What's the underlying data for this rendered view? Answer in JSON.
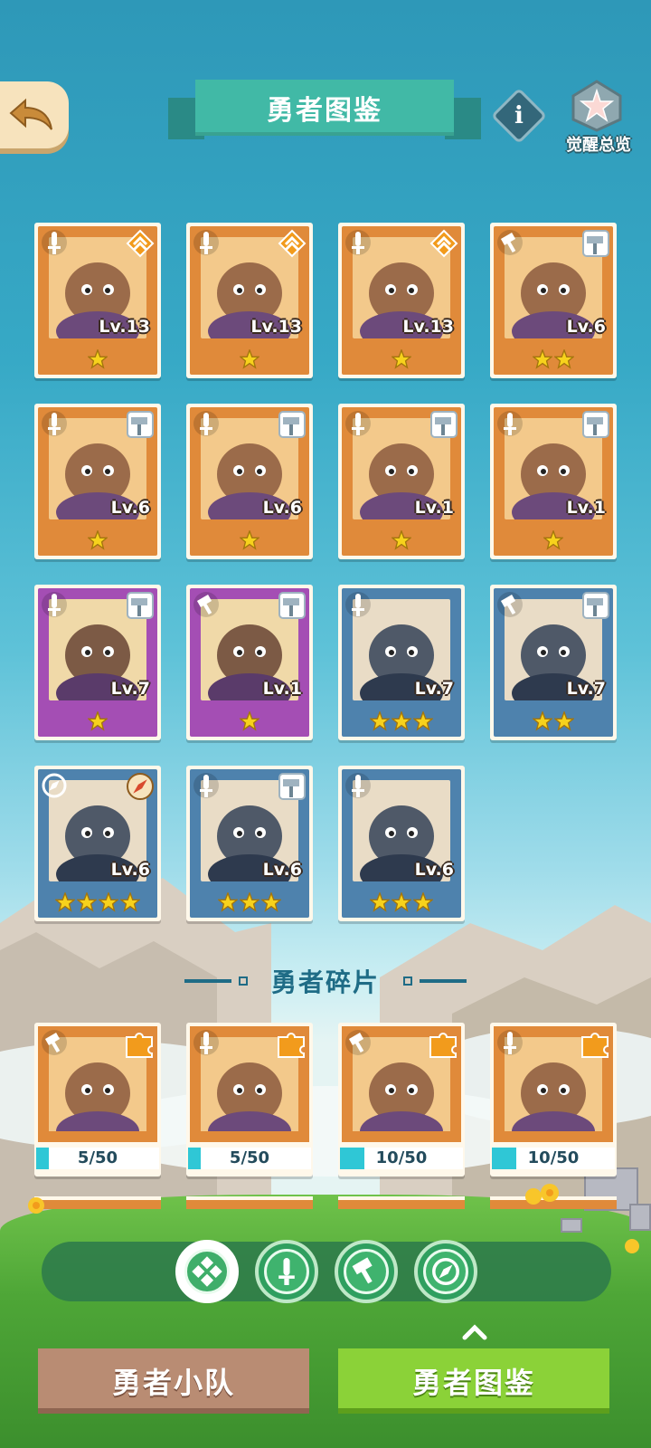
{
  "header": {
    "title": "勇者图鉴",
    "awaken_label": "觉醒总览",
    "info_label": "i"
  },
  "colors": {
    "orange_frame": "#e08a3a",
    "purple_frame": "#a44eb4",
    "blue_frame": "#4e82ad",
    "progress_fill": "#2fc7d6",
    "active_tab": "#8bd238",
    "inactive_tab": "#b98c73"
  },
  "heroes": [
    {
      "level": "Lv.13",
      "stars": 1,
      "rarity": "orange",
      "class_icon": "sword-icon",
      "badge_icon": "rank-chevron-icon",
      "portrait": "elephant-portrait"
    },
    {
      "level": "Lv.13",
      "stars": 1,
      "rarity": "orange",
      "class_icon": "sword-icon",
      "badge_icon": "rank-chevron-icon",
      "portrait": "monkey-king-portrait"
    },
    {
      "level": "Lv.13",
      "stars": 1,
      "rarity": "orange",
      "class_icon": "sword-icon",
      "badge_icon": "rank-chevron-icon",
      "portrait": "squirrel-portrait"
    },
    {
      "level": "Lv.6",
      "stars": 2,
      "rarity": "orange",
      "class_icon": "hammer-icon",
      "badge_icon": "hammer-badge-icon",
      "portrait": "bear-general-portrait"
    },
    {
      "level": "Lv.6",
      "stars": 1,
      "rarity": "orange",
      "class_icon": "sword-icon",
      "badge_icon": "hammer-badge-icon",
      "portrait": "dragon-portrait"
    },
    {
      "level": "Lv.6",
      "stars": 1,
      "rarity": "orange",
      "class_icon": "sword-icon",
      "badge_icon": "hammer-badge-icon",
      "portrait": "white-wolf-portrait"
    },
    {
      "level": "Lv.1",
      "stars": 1,
      "rarity": "orange",
      "class_icon": "sword-icon",
      "badge_icon": "hammer-badge-icon",
      "portrait": "penguin-portrait"
    },
    {
      "level": "Lv.1",
      "stars": 1,
      "rarity": "orange",
      "class_icon": "sword-icon",
      "badge_icon": "hammer-badge-icon",
      "portrait": "red-panda-portrait"
    },
    {
      "level": "Lv.7",
      "stars": 1,
      "rarity": "purple",
      "class_icon": "sword-icon",
      "badge_icon": "hammer-badge-icon",
      "portrait": "lizard-portrait"
    },
    {
      "level": "Lv.1",
      "stars": 1,
      "rarity": "purple",
      "class_icon": "hammer-icon",
      "badge_icon": "hammer-badge-icon",
      "portrait": "boar-portrait"
    },
    {
      "level": "Lv.7",
      "stars": 3,
      "rarity": "blue",
      "class_icon": "sword-icon",
      "badge_icon": "none",
      "portrait": "raccoon-portrait"
    },
    {
      "level": "Lv.7",
      "stars": 2,
      "rarity": "blue",
      "class_icon": "hammer-icon",
      "badge_icon": "hammer-badge-icon",
      "portrait": "hooded-girl-portrait"
    },
    {
      "level": "Lv.6",
      "stars": 4,
      "rarity": "blue",
      "class_icon": "compass-icon",
      "badge_icon": "compass-badge-icon",
      "portrait": "frog-portrait"
    },
    {
      "level": "Lv.6",
      "stars": 3,
      "rarity": "blue",
      "class_icon": "sword-icon",
      "badge_icon": "hammer-badge-icon",
      "portrait": "rabbit-portrait"
    },
    {
      "level": "Lv.6",
      "stars": 3,
      "rarity": "blue",
      "class_icon": "sword-icon",
      "badge_icon": "none",
      "portrait": "fox-officer-portrait"
    }
  ],
  "fragments_section": {
    "title": "勇者碎片",
    "items": [
      {
        "progress": "5/50",
        "ratio": 0.1,
        "class_icon": "hammer-icon",
        "portrait": "lion-portrait"
      },
      {
        "progress": "5/50",
        "ratio": 0.1,
        "class_icon": "sword-icon",
        "portrait": "armored-bull-portrait"
      },
      {
        "progress": "10/50",
        "ratio": 0.2,
        "class_icon": "hammer-icon",
        "portrait": "gorilla-portrait"
      },
      {
        "progress": "10/50",
        "ratio": 0.2,
        "class_icon": "sword-icon",
        "portrait": "fox-girl-portrait"
      }
    ]
  },
  "filters": [
    {
      "icon": "all-icon",
      "active": true
    },
    {
      "icon": "sword-icon",
      "active": false
    },
    {
      "icon": "hammer-icon",
      "active": false
    },
    {
      "icon": "compass-icon",
      "active": false
    }
  ],
  "tabs": {
    "team": "勇者小队",
    "codex": "勇者图鉴",
    "selected": "codex"
  }
}
